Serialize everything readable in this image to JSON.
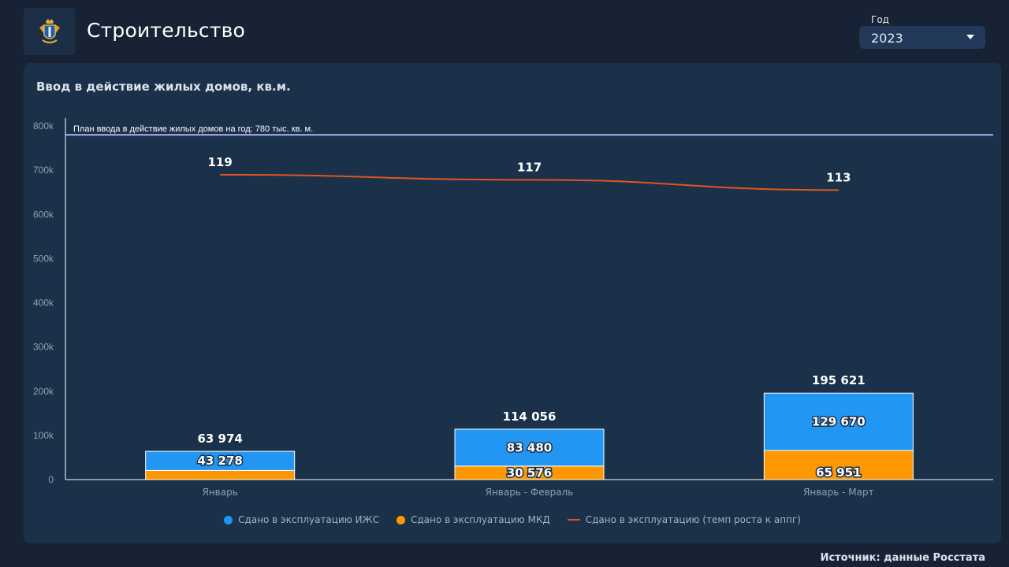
{
  "header": {
    "title": "Строительство",
    "year_label": "Год",
    "year_value": "2023"
  },
  "card": {
    "title": "Ввод в действие жилых домов, кв.м."
  },
  "source": "Источник: данные Росстата",
  "colors": {
    "izhs": "#2196f3",
    "mkd": "#ff9800",
    "growth": "#e0561f",
    "plan": "#a9b4f2"
  },
  "chart_data": {
    "type": "bar",
    "stacked": true,
    "categories": [
      "Январь",
      "Январь - Февраль",
      "Январь - Март"
    ],
    "series": [
      {
        "name": "Сдано в эксплуатацию ИЖС",
        "values": [
          43278,
          83480,
          129670
        ],
        "labels": [
          "43 278",
          "83 480",
          "129 670"
        ]
      },
      {
        "name": "Сдано в эксплуатацию МКД",
        "values": [
          20696,
          30576,
          65951
        ],
        "labels": [
          "",
          "30 576",
          "65 951"
        ]
      }
    ],
    "totals": [
      63974,
      114056,
      195621
    ],
    "total_labels": [
      "63 974",
      "114 056",
      "195 621"
    ],
    "line_series": {
      "name": "Сдано в эксплуатацию (темп роста к аппг)",
      "values": [
        119,
        117,
        113
      ],
      "labels": [
        "119",
        "117",
        "113"
      ]
    },
    "reference_line": {
      "value": 780000,
      "label": "План ввода в действие жилых домов на год: 780 тыс. кв. м."
    },
    "y_ticks": [
      0,
      100000,
      200000,
      300000,
      400000,
      500000,
      600000,
      700000,
      800000
    ],
    "y_tick_labels": [
      "0",
      "100k",
      "200k",
      "300k",
      "400k",
      "500k",
      "600k",
      "700k",
      "800k"
    ],
    "ylim": [
      0,
      800000
    ],
    "line_ylim": [
      0,
      138
    ],
    "legend_position": "bottom",
    "grid": false
  }
}
